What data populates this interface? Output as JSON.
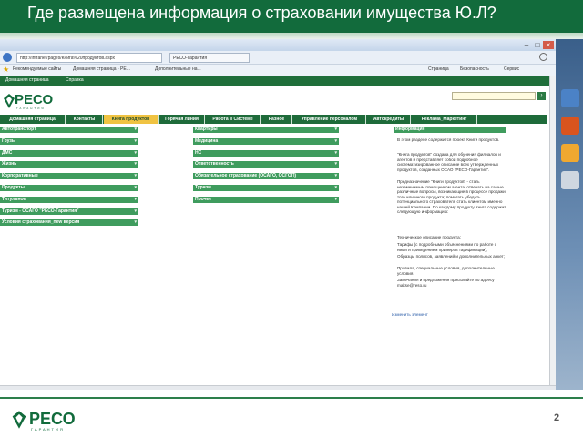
{
  "slide": {
    "title": "Где размещена информация о страховании имущества Ю.Л?",
    "page_number": "2"
  },
  "colors": {
    "header_green": "#126b3c",
    "nav_green": "#1e6b3a",
    "category_green": "#3f9c5e",
    "active_tab_yellow": "#f0c342"
  },
  "browser": {
    "address": "http://intranet/pages/Книга%20продуктов.aspx",
    "tabs": [
      "РЕСО-Гарантия"
    ],
    "favorites": [
      "Рекомендуемые сайты",
      "Домашняя страница - РЕ...",
      "Дополнительные на..."
    ],
    "toolbar_right": [
      "Страница",
      "Безопасность",
      "Сервис"
    ],
    "menu": [
      "Домашняя страница",
      "Справка"
    ]
  },
  "logo": {
    "name": "РЕСО",
    "subtitle": "ГАРАНТИЯ"
  },
  "nav_tabs": [
    {
      "label": "Домашняя страница",
      "active": false
    },
    {
      "label": "Контакты",
      "active": false
    },
    {
      "label": "Книга продуктов",
      "active": true
    },
    {
      "label": "Горячая линия",
      "active": false
    },
    {
      "label": "Работа в Системе",
      "active": false
    },
    {
      "label": "Разное",
      "active": false
    },
    {
      "label": "Управление персоналом",
      "active": false
    },
    {
      "label": "Автокредиты",
      "active": false
    },
    {
      "label": "Реклама_Маркетинг",
      "active": false
    }
  ],
  "left_categories": [
    "Автотранспорт",
    "Грузы",
    "ДМС",
    "Жизнь",
    "Корпоративные",
    "Продукты",
    "Титульное",
    "Туризм - ОСАГО \"РЕСО-Гарантия\"",
    "Условия страхования_new версия"
  ],
  "middle_categories": [
    "Квартиры",
    "Медицина",
    "НС",
    "Ответственность",
    "Обязательное страхование (ОСАГО, ОСГОП)",
    "Туризм",
    "Прочее"
  ],
  "info": {
    "header": "Информация",
    "paragraphs": [
      "В этом разделе содержится проект Книги продуктов.",
      "\"Книга продуктов\" создана для обучения филиалов и агентов и представляет собой подробное систематизированное описание всех утвержденных продуктов, созданных ОСАО \"РЕСО-Гарантия\".",
      "Предназначение \"Книги продуктов\" - стать незаменимым помощником агента: отвечать на самые различные вопросы, возникающие в процессе продажи того или иного продукта; помогать убедить потенциального страхователя стать клиентом именно нашей Компании. По каждому продукту Книга содержит следующую информацию:",
      "Техническое описание продукта;",
      "Тарифы (с подробными объяснениями по работе с ними и приведением примеров тарификации);",
      "Образцы полисов, заявлений и дополнительных анкет;",
      "Правила, специальные условия, дополнительные условия.",
      "Замечания и предложения присылайте по адресу makse@reso.ru"
    ],
    "link": "Изменить элемент"
  },
  "footer": {
    "logo_name": "РЕСО",
    "logo_subtitle": "ГАРАНТИЯ"
  }
}
